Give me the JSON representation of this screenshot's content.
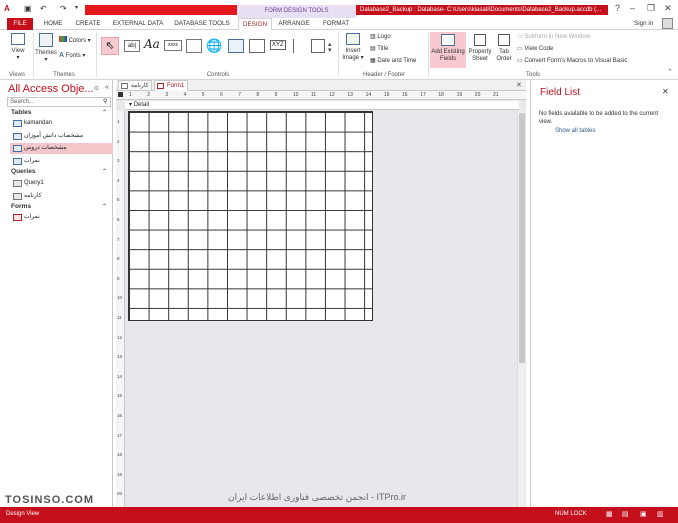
{
  "title_bar": {
    "context_tab": "FORM DESIGN TOOLS",
    "window_title": "Database2_Backup : Database- C:\\Users\\kiasati\\Documents\\Database2_Backup.accdb (...",
    "help": "?",
    "sign_in": "Sign in"
  },
  "ribbon_tabs": [
    "FILE",
    "HOME",
    "CREATE",
    "EXTERNAL DATA",
    "DATABASE TOOLS",
    "DESIGN",
    "ARRANGE",
    "FORMAT"
  ],
  "active_tab": "DESIGN",
  "ribbon": {
    "view_label": "View",
    "themes_label": "Themes",
    "colors_label": "Colors",
    "fonts_label": "Fonts",
    "insert_image_label": "Insert Image",
    "logo_label": "Logo",
    "title_label": "Title",
    "date_time_label": "Date and Time",
    "add_existing_fields_label": "Add Existing Fields",
    "property_sheet_label": "Property Sheet",
    "tab_order_label": "Tab Order",
    "subform_label": "Subform in New Window",
    "view_code_label": "View Code",
    "convert_macros_label": "Convert Form's Macros to Visual Basic",
    "groups": {
      "views": "Views",
      "themes": "Themes",
      "controls": "Controls",
      "header_footer": "Header / Footer",
      "tools": "Tools"
    },
    "controls_glyphs": {
      "aa": "Aa",
      "xxxx": "xxxx",
      "xyz": "XYZ"
    }
  },
  "nav_pane": {
    "title": "All Access Obje...",
    "search_placeholder": "Search...",
    "sections": {
      "tables": "Tables",
      "queries": "Queries",
      "forms": "Forms"
    },
    "tables": [
      "kamandan",
      "مشخصات دانش آموزان",
      "مشخصات دروس",
      "نمرات"
    ],
    "selected_table_index": 2,
    "queries": [
      "Query1",
      "کارنامه"
    ],
    "forms": [
      "نمرات"
    ]
  },
  "document_tabs": [
    {
      "label": "کارنامه",
      "active": false
    },
    {
      "label": "Form1",
      "active": true
    }
  ],
  "designer": {
    "section_label": "Detail",
    "ruler_numbers": [
      "1",
      "2",
      "3",
      "4",
      "5",
      "6",
      "7",
      "8",
      "9",
      "10",
      "11",
      "12",
      "13",
      "14",
      "15",
      "16",
      "17",
      "18",
      "19",
      "20",
      "21"
    ],
    "vruler_numbers": [
      "1",
      "2",
      "3",
      "4",
      "5",
      "6",
      "7",
      "8",
      "9",
      "10",
      "11",
      "12",
      "13",
      "14",
      "15",
      "16",
      "17",
      "18",
      "19",
      "20"
    ]
  },
  "field_list": {
    "title": "Field List",
    "message": "No fields available to be added to the current view.",
    "link": "Show all tables"
  },
  "status_bar": {
    "left": "Design View",
    "num_lock": "NUM LOCK"
  },
  "watermark": {
    "left": "TOSINSO.COM",
    "center": "انجمن تخصصی فناوری اطلاعات ایران - ITPro.ir"
  },
  "colors": {
    "accent": "#c3101c",
    "context": "#6a3d9a",
    "selected_item": "#f3c6c9"
  }
}
